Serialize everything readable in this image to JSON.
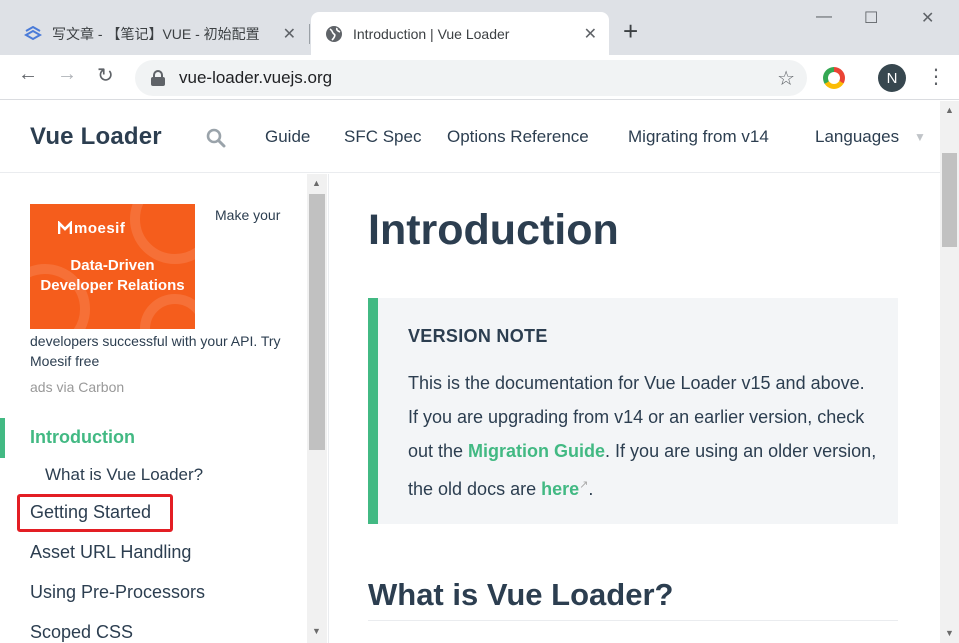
{
  "browser": {
    "tabs": [
      {
        "title": "写文章 - 【笔记】VUE - 初始配置",
        "icon": "csdn-write-icon",
        "active": false
      },
      {
        "title": "Introduction | Vue Loader",
        "icon": "globe-icon",
        "active": true
      }
    ],
    "close_glyph": "✕",
    "new_tab_glyph": "+",
    "window_controls": {
      "minimize": "—",
      "maximize": "☐",
      "close": "✕"
    },
    "nav": {
      "back": "←",
      "forward": "→",
      "reload": "↻"
    },
    "url": "vue-loader.vuejs.org",
    "bookmark_glyph": "☆",
    "profile_initial": "N",
    "menu_glyph": "⋮"
  },
  "site": {
    "title": "Vue Loader",
    "nav_links": [
      "Guide",
      "SFC Spec",
      "Options Reference",
      "Migrating from v14",
      "Languages"
    ],
    "languages_caret": "▼"
  },
  "sidebar": {
    "ad": {
      "brand": "moesif",
      "headline_line1": "Data-Driven",
      "headline_line2": "Developer Relations",
      "text_a": "Make your",
      "text_b": "developers successful with your API. Try Moesif free",
      "via": "ads via Carbon"
    },
    "items": [
      {
        "label": "Introduction",
        "active": true
      },
      {
        "label": "Getting Started",
        "active": false
      },
      {
        "label": "Asset URL Handling",
        "active": false
      },
      {
        "label": "Using Pre-Processors",
        "active": false
      },
      {
        "label": "Scoped CSS",
        "active": false
      }
    ],
    "sub_items": [
      "What is Vue Loader?"
    ],
    "scroll_up": "▲",
    "scroll_down": "▼"
  },
  "main": {
    "heading": "Introduction",
    "note": {
      "title": "VERSION NOTE",
      "text_1": "This is the documentation for Vue Loader v15 and above. If you are upgrading from v14 or an earlier version, check out the ",
      "link_1": "Migration Guide",
      "text_2": ". If you are using an older version, the old docs are ",
      "link_2": "here",
      "ext_glyph": "↗",
      "text_3": "."
    },
    "heading_2": "What is Vue Loader?"
  },
  "colors": {
    "accent": "#42b983",
    "text": "#2c3e50",
    "highlight": "#e31e24",
    "ad_bg": "#f55d1c"
  }
}
